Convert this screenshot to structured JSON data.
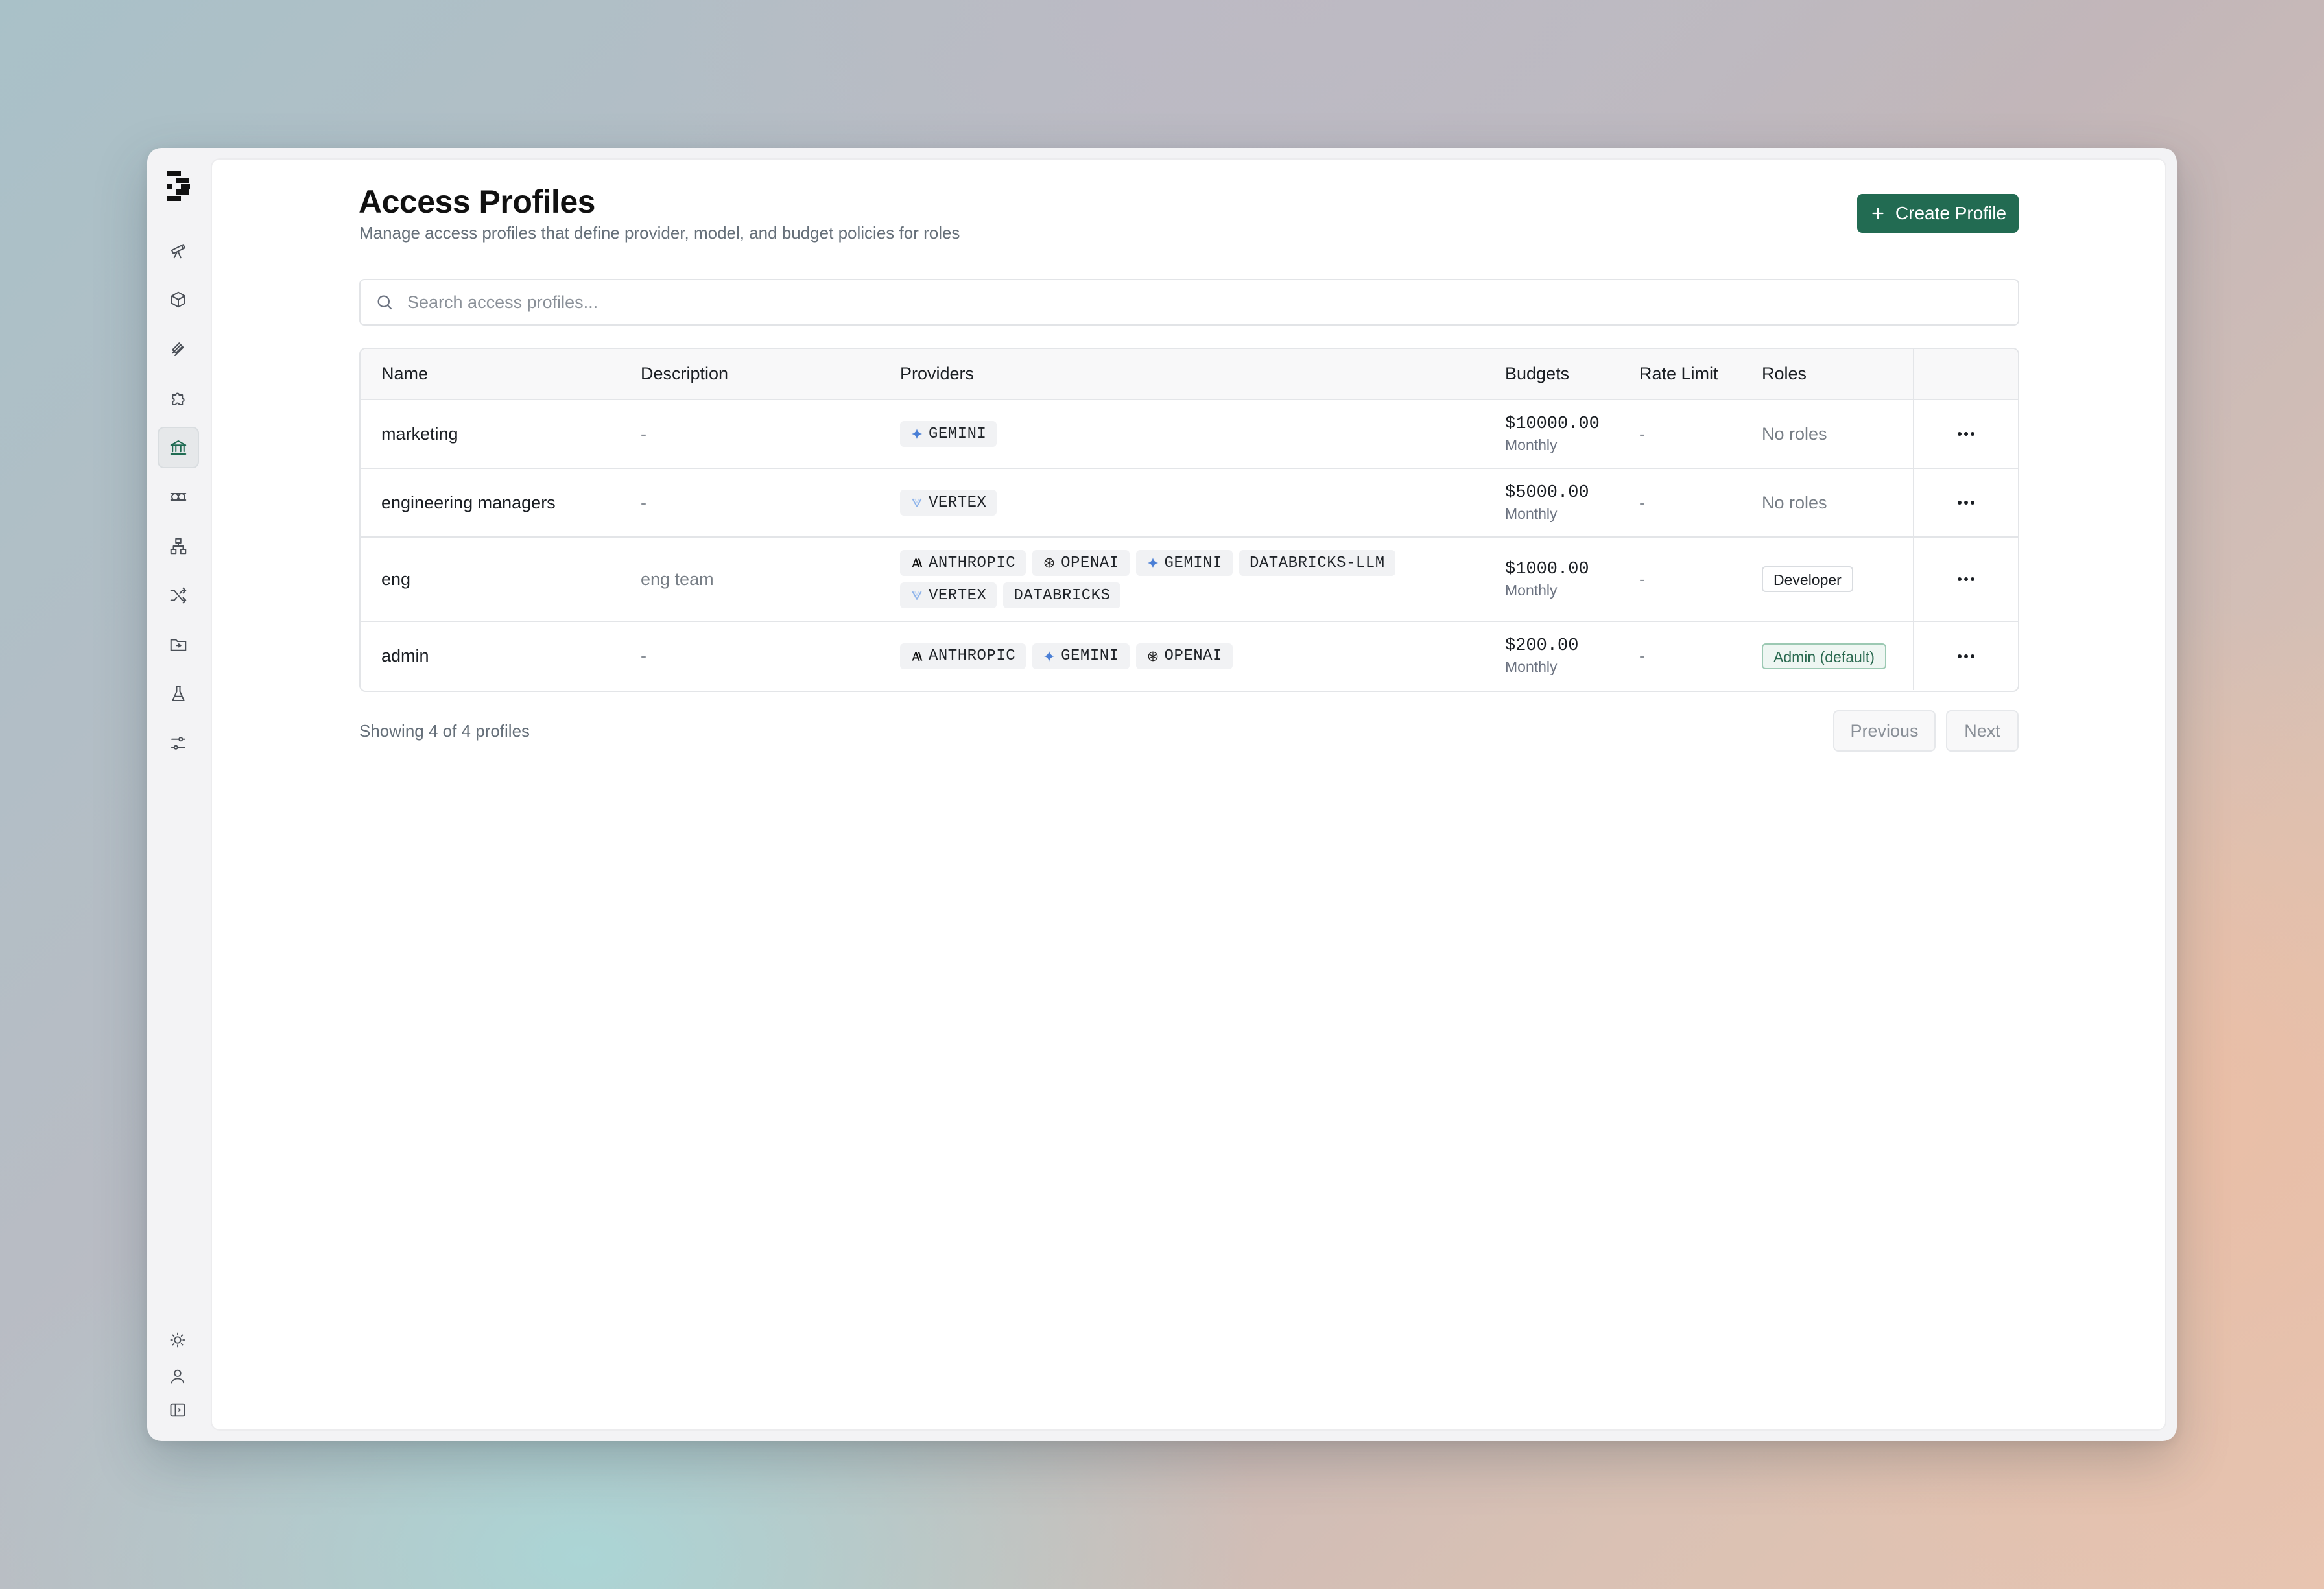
{
  "page": {
    "title": "Access Profiles",
    "subtitle": "Manage access profiles that define provider, model, and budget policies for roles",
    "create_button": "Create Profile"
  },
  "search": {
    "placeholder": "Search access profiles..."
  },
  "sidebar": {
    "items": [
      {
        "icon": "telescope-icon"
      },
      {
        "icon": "box-icon"
      },
      {
        "icon": "layers-icon"
      },
      {
        "icon": "puzzle-icon"
      },
      {
        "icon": "bank-icon",
        "active": true
      },
      {
        "icon": "coin-off-icon"
      },
      {
        "icon": "network-icon"
      },
      {
        "icon": "shuffle-icon"
      },
      {
        "icon": "folder-icon"
      },
      {
        "icon": "flask-icon"
      },
      {
        "icon": "sliders-icon"
      }
    ],
    "bottom": [
      {
        "icon": "sun-icon"
      },
      {
        "icon": "user-icon"
      },
      {
        "icon": "sidebar-toggle-icon"
      }
    ]
  },
  "table": {
    "headers": {
      "name": "Name",
      "description": "Description",
      "providers": "Providers",
      "budgets": "Budgets",
      "rate_limit": "Rate Limit",
      "roles": "Roles"
    },
    "rows": [
      {
        "name": "marketing",
        "description": "-",
        "providers": [
          {
            "label": "GEMINI",
            "icon": "gemini-icon"
          }
        ],
        "budget_amount": "$10000.00",
        "budget_period": "Monthly",
        "rate_limit": "-",
        "roles": "No roles"
      },
      {
        "name": "engineering managers",
        "description": "-",
        "providers": [
          {
            "label": "VERTEX",
            "icon": "vertex-icon"
          }
        ],
        "budget_amount": "$5000.00",
        "budget_period": "Monthly",
        "rate_limit": "-",
        "roles": "No roles"
      },
      {
        "name": "eng",
        "description": "eng team",
        "providers": [
          {
            "label": "ANTHROPIC",
            "icon": "anthropic-icon"
          },
          {
            "label": "OPENAI",
            "icon": "openai-icon"
          },
          {
            "label": "GEMINI",
            "icon": "gemini-icon"
          },
          {
            "label": "DATABRICKS-LLM",
            "icon": ""
          },
          {
            "label": "VERTEX",
            "icon": "vertex-icon"
          },
          {
            "label": "DATABRICKS",
            "icon": ""
          }
        ],
        "budget_amount": "$1000.00",
        "budget_period": "Monthly",
        "rate_limit": "-",
        "roles": "Developer"
      },
      {
        "name": "admin",
        "description": "-",
        "providers": [
          {
            "label": "ANTHROPIC",
            "icon": "anthropic-icon"
          },
          {
            "label": "GEMINI",
            "icon": "gemini-icon"
          },
          {
            "label": "OPENAI",
            "icon": "openai-icon"
          }
        ],
        "budget_amount": "$200.00",
        "budget_period": "Monthly",
        "rate_limit": "-",
        "roles": "Admin (default)"
      }
    ]
  },
  "footer": {
    "showing": "Showing 4 of 4 profiles",
    "previous": "Previous",
    "next": "Next"
  },
  "colors": {
    "accent": "#226b52",
    "admin_badge_bg": "#eef6f2",
    "admin_badge_text": "#2a6a50"
  }
}
